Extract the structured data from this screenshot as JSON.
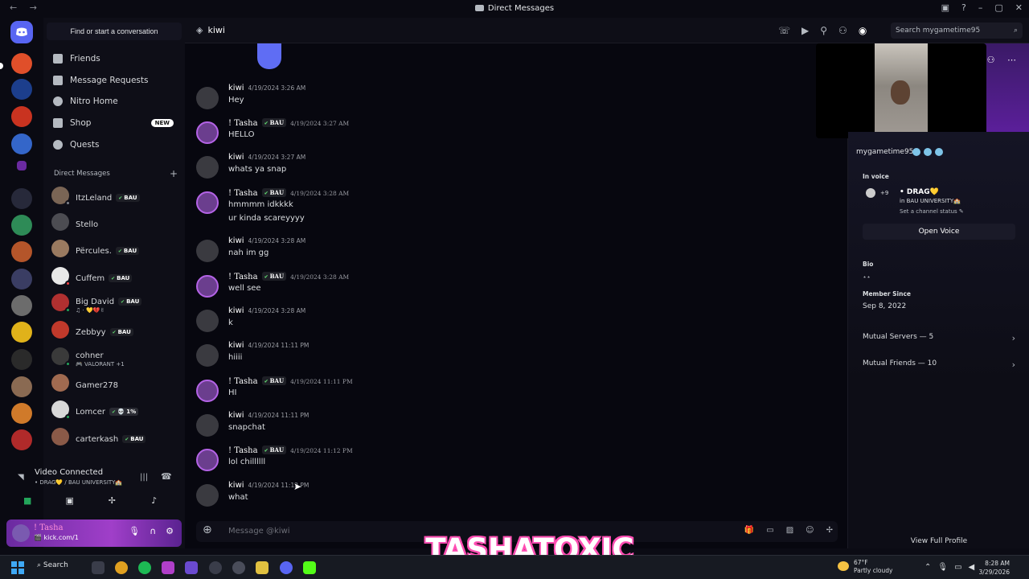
{
  "window": {
    "title": "Direct Messages"
  },
  "search_dm": {
    "placeholder": "Find or start a conversation"
  },
  "nav": [
    {
      "label": "Friends",
      "icon": "friends-icon"
    },
    {
      "label": "Message Requests",
      "icon": "mail-icon"
    },
    {
      "label": "Nitro Home",
      "icon": "nitro-icon"
    },
    {
      "label": "Shop",
      "icon": "shop-icon",
      "badge": "NEW"
    },
    {
      "label": "Quests",
      "icon": "quests-icon"
    }
  ],
  "dm_header": "Direct Messages",
  "dms": [
    {
      "name": "ItzLeland",
      "tag": "BAU",
      "sub": ""
    },
    {
      "name": "Stello",
      "tag": "",
      "sub": ""
    },
    {
      "name": "Përcules.",
      "tag": "BAU",
      "sub": ""
    },
    {
      "name": "Cuffem",
      "tag": "BAU",
      "sub": ""
    },
    {
      "name": "Big David",
      "tag": "BAU",
      "sub": "♫ · 💛💔✌"
    },
    {
      "name": "Zebbyy",
      "tag": "BAU",
      "sub": ""
    },
    {
      "name": "cohner",
      "tag": "",
      "sub": "🎮 VALORANT +1"
    },
    {
      "name": "Gamer278",
      "tag": "",
      "sub": ""
    },
    {
      "name": "Lomcer",
      "tag": "",
      "sub": ""
    },
    {
      "name": "carterkash",
      "tag": "BAU",
      "sub": ""
    }
  ],
  "voice": {
    "title": "Video Connected",
    "sub": "• DRAG💛 / BAU UNIVERSITY🏫"
  },
  "user": {
    "name": "! Tasha",
    "status": "🎬 kick.com/1"
  },
  "chat": {
    "recipient": "kiwi",
    "search_placeholder": "Search mygametime95",
    "composer_placeholder": "Message @kiwi",
    "messages": [
      {
        "author": "kiwi",
        "tag": "",
        "time": "4/19/2024 3:26 AM",
        "text": "Hey",
        "text2": ""
      },
      {
        "author": "! Tasha",
        "tag": "BAU",
        "time": "4/19/2024 3:27 AM",
        "text": "HELLO",
        "text2": ""
      },
      {
        "author": "kiwi",
        "tag": "",
        "time": "4/19/2024 3:27 AM",
        "text": "whats ya snap",
        "text2": ""
      },
      {
        "author": "! Tasha",
        "tag": "BAU",
        "time": "4/19/2024 3:28 AM",
        "text": "hmmmm idkkkk",
        "text2": "ur kinda scareyyyy"
      },
      {
        "author": "kiwi",
        "tag": "",
        "time": "4/19/2024 3:28 AM",
        "text": "nah im gg",
        "text2": ""
      },
      {
        "author": "! Tasha",
        "tag": "BAU",
        "time": "4/19/2024 3:28 AM",
        "text": "well see",
        "text2": ""
      },
      {
        "author": "kiwi",
        "tag": "",
        "time": "4/19/2024 3:28 AM",
        "text": "k",
        "text2": ""
      },
      {
        "author": "kiwi",
        "tag": "",
        "time": "4/19/2024 11:11 PM",
        "text": "hiiii",
        "text2": ""
      },
      {
        "author": "! Tasha",
        "tag": "BAU",
        "time": "4/19/2024 11:11 PM",
        "text": "HI",
        "text2": ""
      },
      {
        "author": "kiwi",
        "tag": "",
        "time": "4/19/2024 11:11 PM",
        "text": "snapchat",
        "text2": ""
      },
      {
        "author": "! Tasha",
        "tag": "BAU",
        "time": "4/19/2024 11:12 PM",
        "text": "lol chillllll",
        "text2": ""
      },
      {
        "author": "kiwi",
        "tag": "",
        "time": "4/19/2024 11:12 PM",
        "text": "what",
        "text2": ""
      }
    ]
  },
  "profile": {
    "username": "mygametime95",
    "in_voice_label": "In voice",
    "channel": "• DRAG💛",
    "server": "in BAU UNIVERSITY🏫",
    "channel_status": "Set a channel status ✎",
    "member_count": "+9",
    "open_voice": "Open Voice",
    "bio_label": "Bio",
    "bio": "⋆⋆",
    "member_since_label": "Member Since",
    "member_since": "Sep 8, 2022",
    "mutual_servers": "Mutual Servers — 5",
    "mutual_friends": "Mutual Friends — 10",
    "view_full": "View Full Profile"
  },
  "overlay_text": "TASHATOXIC",
  "taskbar": {
    "search": "Search",
    "temp": "67°F",
    "weather": "Partly cloudy",
    "time": "8:28 AM",
    "date": "3/29/2026"
  }
}
